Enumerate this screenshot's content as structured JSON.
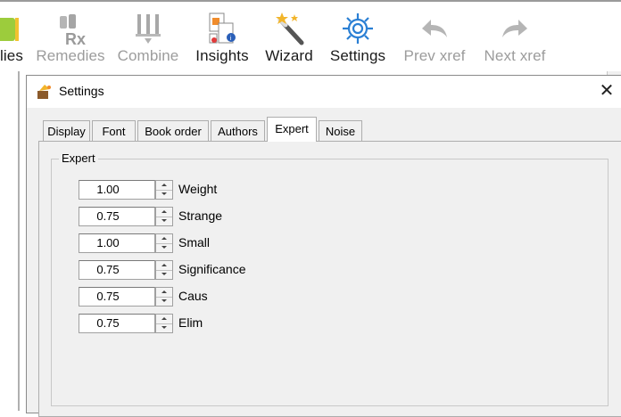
{
  "toolbar": {
    "items": [
      {
        "label": "lies",
        "state": "enabled",
        "icon": "colored-square-icon"
      },
      {
        "label": "Remedies",
        "state": "disabled",
        "icon": "rx-bottles-icon"
      },
      {
        "label": "Combine",
        "state": "disabled",
        "icon": "combine-tubes-icon"
      },
      {
        "label": "Insights",
        "state": "enabled",
        "icon": "documents-info-icon"
      },
      {
        "label": "Wizard",
        "state": "enabled",
        "icon": "magic-wand-icon"
      },
      {
        "label": "Settings",
        "state": "enabled",
        "icon": "gear-icon"
      },
      {
        "label": "Prev xref",
        "state": "disabled",
        "icon": "undo-arrow-icon"
      },
      {
        "label": "Next xref",
        "state": "disabled",
        "icon": "redo-arrow-icon"
      }
    ]
  },
  "dialog": {
    "title": "Settings",
    "close_glyph": "✕",
    "tabs": [
      {
        "label": "Display",
        "active": false
      },
      {
        "label": "Font",
        "active": false
      },
      {
        "label": "Book order",
        "active": false
      },
      {
        "label": "Authors",
        "active": false
      },
      {
        "label": "Expert",
        "active": true
      },
      {
        "label": "Noise",
        "active": false
      }
    ],
    "group_title": "Expert",
    "fields": [
      {
        "label": "Weight",
        "value": "1.00"
      },
      {
        "label": "Strange",
        "value": "0.75"
      },
      {
        "label": "Small",
        "value": "1.00"
      },
      {
        "label": "Significance",
        "value": "0.75"
      },
      {
        "label": "Caus",
        "value": "0.75"
      },
      {
        "label": "Elim",
        "value": "0.75"
      }
    ]
  },
  "colors": {
    "enabled_text": "#1a1a1a",
    "disabled_text": "#9c9c9c",
    "gear_blue": "#2a7fd4",
    "wand_gold": "#f2b52b",
    "dialog_bg": "#f0f0f0"
  }
}
